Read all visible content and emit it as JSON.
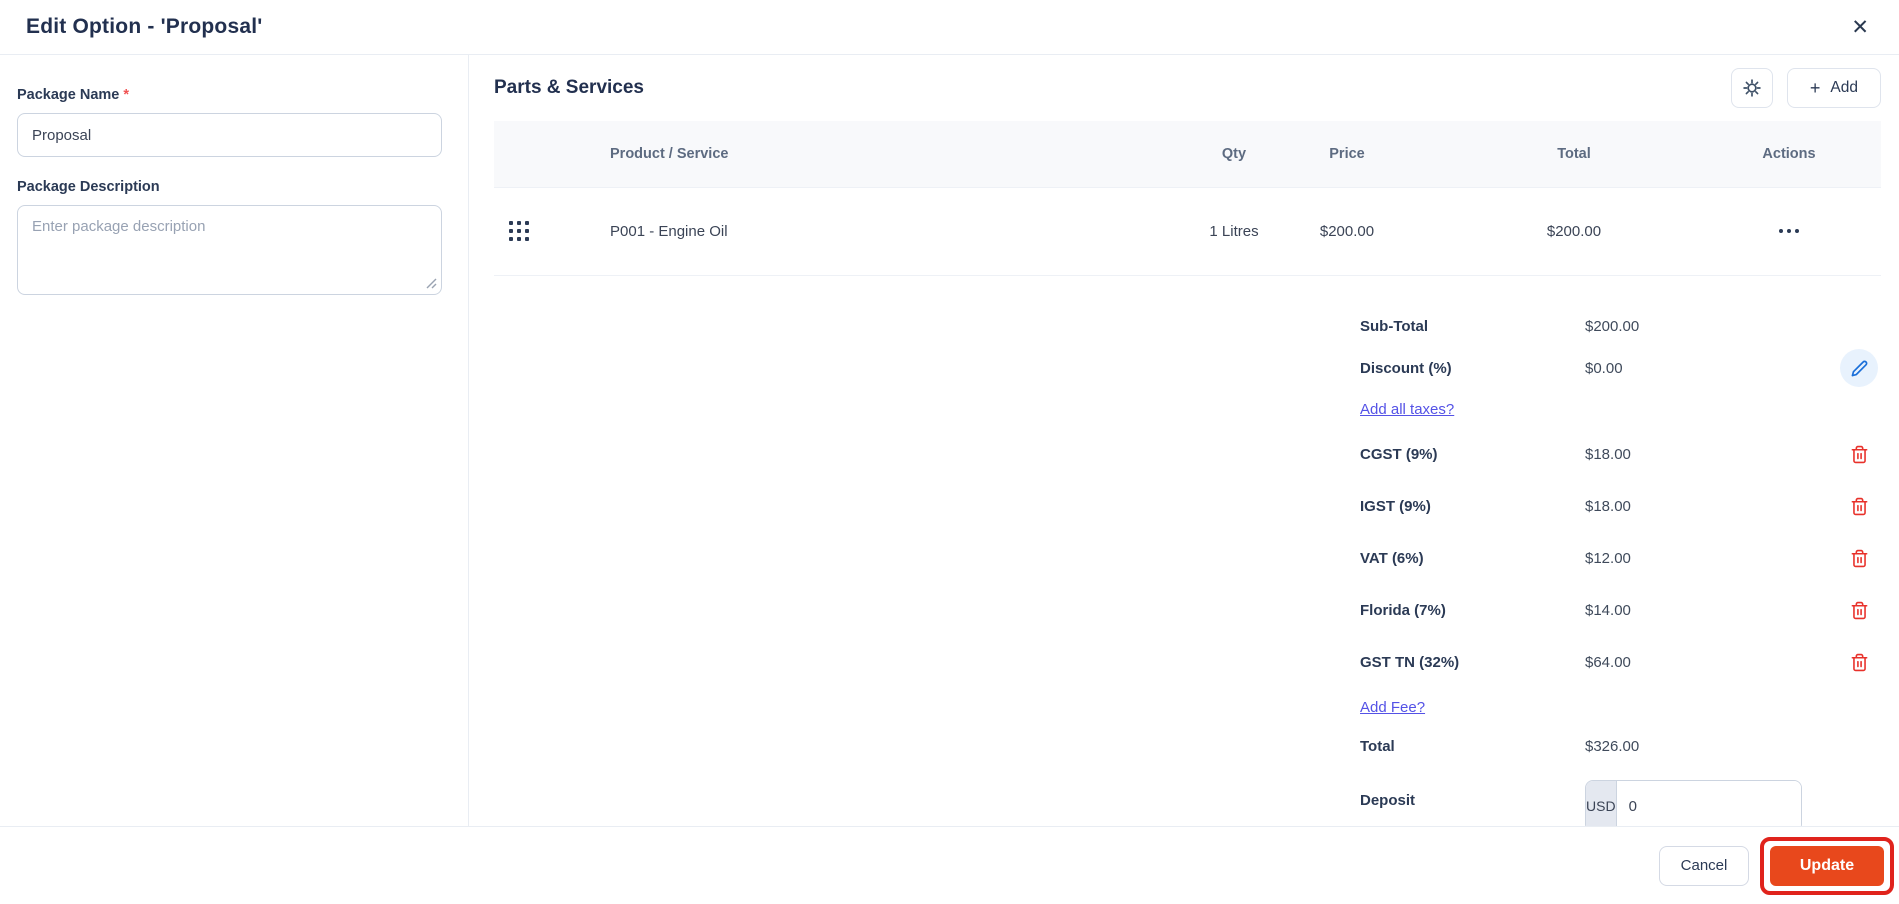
{
  "modal": {
    "title": "Edit Option - 'Proposal'"
  },
  "icons": {
    "close": "✕",
    "plus": "+"
  },
  "form": {
    "package_name": {
      "label": "Package Name",
      "required_mark": "*",
      "value": "Proposal"
    },
    "package_description": {
      "label": "Package Description",
      "placeholder": "Enter package description"
    }
  },
  "parts_services": {
    "title": "Parts & Services",
    "add_button_label": "Add",
    "table": {
      "columns": {
        "product": "Product / Service",
        "qty": "Qty",
        "price": "Price",
        "total": "Total",
        "actions": "Actions"
      },
      "rows": [
        {
          "product": "P001 - Engine Oil",
          "qty": "1 Litres",
          "price": "$200.00",
          "total": "$200.00"
        }
      ]
    },
    "summary": {
      "sub_total": {
        "label": "Sub-Total",
        "value": "$200.00"
      },
      "discount": {
        "label": "Discount (%)",
        "value": "$0.00"
      },
      "add_all_taxes_link": "Add all taxes?",
      "taxes": [
        {
          "label": "CGST (9%)",
          "value": "$18.00"
        },
        {
          "label": "IGST (9%)",
          "value": "$18.00"
        },
        {
          "label": "VAT (6%)",
          "value": "$12.00"
        },
        {
          "label": "Florida (7%)",
          "value": "$14.00"
        },
        {
          "label": "GST TN (32%)",
          "value": "$64.00"
        }
      ],
      "add_fee_link": "Add Fee?",
      "total": {
        "label": "Total",
        "value": "$326.00"
      },
      "deposit": {
        "label": "Deposit",
        "currency": "USD",
        "value": "0"
      }
    }
  },
  "footer": {
    "cancel_label": "Cancel",
    "update_label": "Update"
  },
  "colors": {
    "accent_orange": "#e8481c",
    "annotation_red": "#e0231c",
    "link_indigo": "#5452e6",
    "danger_red": "#e8312a",
    "edit_blue": "#1a6fd9",
    "heading_navy": "#22304f",
    "table_header_bg": "#f8f9fb"
  }
}
